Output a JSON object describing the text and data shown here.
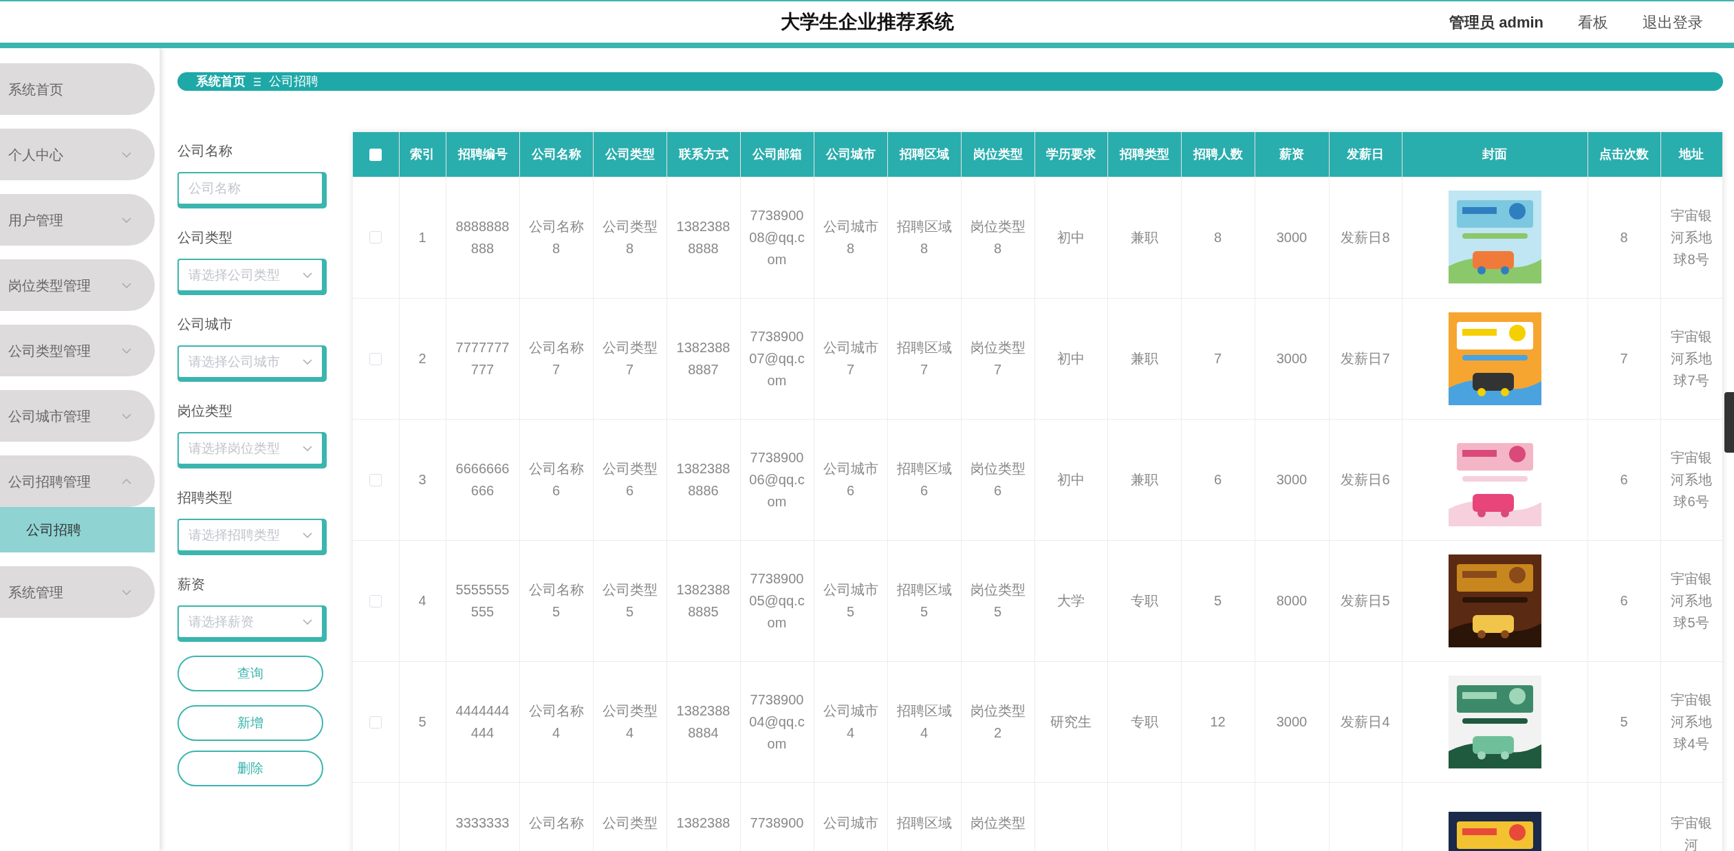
{
  "header": {
    "title": "大学生企业推荐系统",
    "user": "管理员 admin",
    "links": [
      "看板",
      "退出登录"
    ]
  },
  "sidebar": {
    "items": [
      {
        "label": "系统首页",
        "kind": "link"
      },
      {
        "label": "个人中心",
        "kind": "menu",
        "expanded": false
      },
      {
        "label": "用户管理",
        "kind": "menu",
        "expanded": false
      },
      {
        "label": "岗位类型管理",
        "kind": "menu",
        "expanded": false
      },
      {
        "label": "公司类型管理",
        "kind": "menu",
        "expanded": false
      },
      {
        "label": "公司城市管理",
        "kind": "menu",
        "expanded": false
      },
      {
        "label": "公司招聘管理",
        "kind": "menu",
        "expanded": true,
        "children": [
          {
            "label": "公司招聘",
            "selected": true
          }
        ]
      },
      {
        "label": "系统管理",
        "kind": "menu",
        "expanded": false
      }
    ]
  },
  "breadcrumb": [
    "系统首页",
    "公司招聘"
  ],
  "filters": [
    {
      "label": "公司名称",
      "kind": "input",
      "placeholder": "公司名称"
    },
    {
      "label": "公司类型",
      "kind": "select",
      "placeholder": "请选择公司类型"
    },
    {
      "label": "公司城市",
      "kind": "select",
      "placeholder": "请选择公司城市"
    },
    {
      "label": "岗位类型",
      "kind": "select",
      "placeholder": "请选择岗位类型"
    },
    {
      "label": "招聘类型",
      "kind": "select",
      "placeholder": "请选择招聘类型"
    },
    {
      "label": "薪资",
      "kind": "select",
      "placeholder": "请选择薪资"
    }
  ],
  "buttons": [
    "查询",
    "新增",
    "删除"
  ],
  "table": {
    "header_checked": false,
    "columns": [
      "索引",
      "招聘编号",
      "公司名称",
      "公司类型",
      "联系方式",
      "公司邮箱",
      "公司城市",
      "招聘区域",
      "岗位类型",
      "学历要求",
      "招聘类型",
      "招聘人数",
      "薪资",
      "发薪日",
      "封面",
      "点击次数",
      "地址"
    ],
    "rows": [
      {
        "kind": "full",
        "checked": false,
        "cells": [
          "1",
          "8888888888",
          "公司名称8",
          "公司类型8",
          "13823888888",
          "773890008@qq.com",
          "公司城市8",
          "招聘区域8",
          "岗位类型8",
          "初中",
          "兼职",
          "8",
          "3000",
          "发薪日8",
          {
            "kind": "picture"
          },
          "8",
          "宇宙银河系地球8号"
        ]
      },
      {
        "kind": "full",
        "checked": false,
        "cells": [
          "2",
          "7777777777",
          "公司名称7",
          "公司类型7",
          "13823888887",
          "773890007@qq.com",
          "公司城市7",
          "招聘区域7",
          "岗位类型7",
          "初中",
          "兼职",
          "7",
          "3000",
          "发薪日7",
          {
            "kind": "picture"
          },
          "7",
          "宇宙银河系地球7号"
        ]
      },
      {
        "kind": "full",
        "checked": false,
        "cells": [
          "3",
          "6666666666",
          "公司名称6",
          "公司类型6",
          "13823888886",
          "773890006@qq.com",
          "公司城市6",
          "招聘区域6",
          "岗位类型6",
          "初中",
          "兼职",
          "6",
          "3000",
          "发薪日6",
          {
            "kind": "picture"
          },
          "6",
          "宇宙银河系地球6号"
        ]
      },
      {
        "kind": "full",
        "checked": false,
        "cells": [
          "4",
          "5555555555",
          "公司名称5",
          "公司类型5",
          "13823888885",
          "773890005@qq.com",
          "公司城市5",
          "招聘区域5",
          "岗位类型5",
          "大学",
          "专职",
          "5",
          "8000",
          "发薪日5",
          {
            "kind": "picture"
          },
          "6",
          "宇宙银河系地球5号"
        ]
      },
      {
        "kind": "full",
        "checked": false,
        "cells": [
          "5",
          "4444444444",
          "公司名称4",
          "公司类型4",
          "13823888884",
          "773890004@qq.com",
          "公司城市4",
          "招聘区域4",
          "岗位类型2",
          "研究生",
          "专职",
          "12",
          "3000",
          "发薪日4",
          {
            "kind": "picture"
          },
          "5",
          "宇宙银河系地球4号"
        ]
      },
      {
        "kind": "cut",
        "cells": [
          "",
          "3333333",
          "公司名称",
          "公司类型",
          "1382388",
          "7738900",
          "公司城市",
          "招聘区域",
          "岗位类型",
          "",
          "",
          "",
          "",
          "",
          {
            "kind": "picture"
          },
          "",
          "宇宙银河"
        ]
      }
    ]
  }
}
